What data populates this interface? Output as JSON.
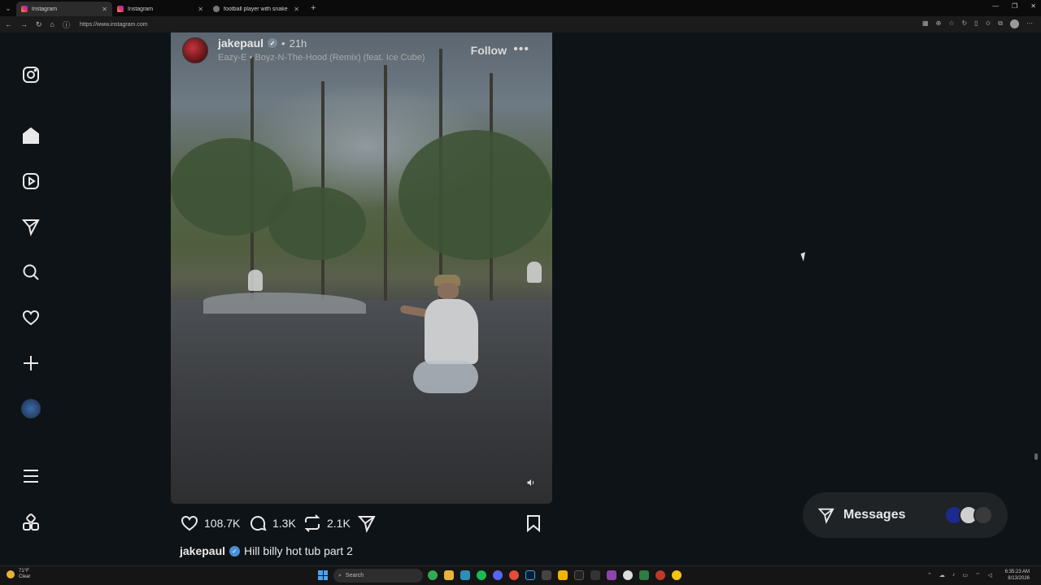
{
  "browser": {
    "tabs": [
      {
        "title": "Instagram",
        "active": true
      },
      {
        "title": "Instagram",
        "active": false
      },
      {
        "title": "football player with snake in helme",
        "active": false
      }
    ],
    "url": "https://www.instagram.com"
  },
  "post": {
    "username": "jakepaul",
    "time": "21h",
    "audio": "Eazy-E • Boyz-N-The-Hood (Remix) (feat. Ice Cube)",
    "follow_label": "Follow",
    "more_label": "•••",
    "likes": "108.7K",
    "comments": "1.3K",
    "reposts": "2.1K",
    "caption_user": "jakepaul",
    "caption_text": "Hill billy hot tub part 2"
  },
  "messages": {
    "label": "Messages"
  },
  "taskbar": {
    "weather_temp": "71°F",
    "weather_cond": "Clear",
    "search_placeholder": "Search",
    "time": "6:35:23 AM",
    "date": "8/13/2026"
  },
  "colors": {
    "accent": "#4b8fd6",
    "background": "#0e1317"
  }
}
